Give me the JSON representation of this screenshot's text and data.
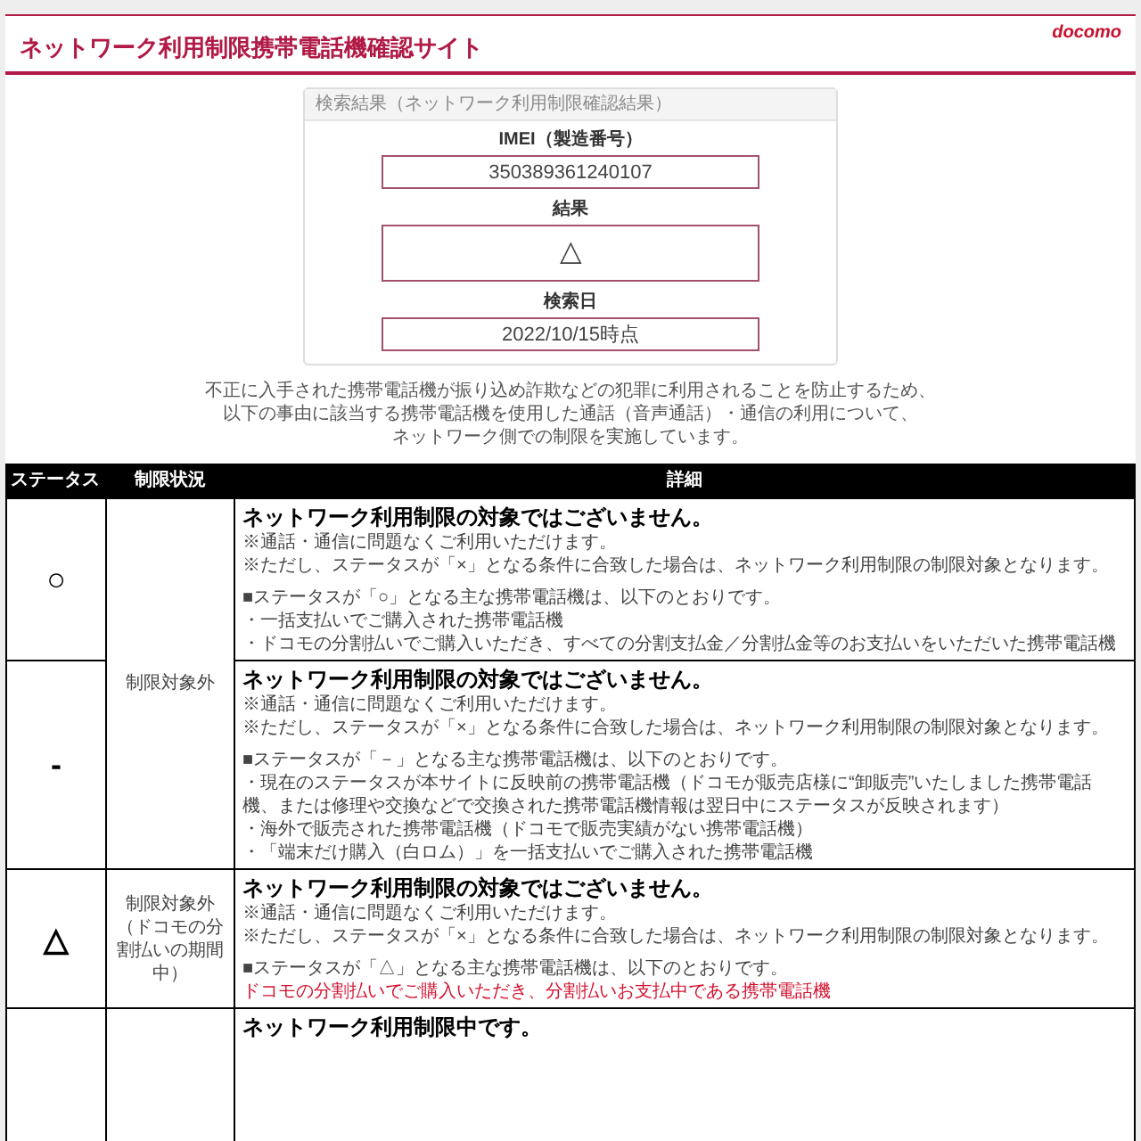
{
  "header": {
    "title": "ネットワーク利用制限携帯電話機確認サイト",
    "logo": "docomo"
  },
  "result": {
    "heading": "検索結果（ネットワーク利用制限確認結果）",
    "fields": [
      {
        "label": "IMEI（製造番号）",
        "value": "350389361240107",
        "kind": "text"
      },
      {
        "label": "結果",
        "value": "△",
        "kind": "symbol"
      },
      {
        "label": "検索日",
        "value": "2022/10/15時点",
        "kind": "text"
      }
    ]
  },
  "notice": [
    "不正に入手された携帯電話機が振り込め詐欺などの犯罪に利用されることを防止するため、",
    "以下の事由に該当する携帯電話機を使用した通話（音声通話）・通信の利用について、",
    "ネットワーク側での制限を実施しています。"
  ],
  "table": {
    "columns": [
      "ステータス",
      "制限状況",
      "詳細"
    ],
    "groups": [
      {
        "restriction": [
          "制限対象外"
        ],
        "rows": [
          {
            "status": "○",
            "detail": {
              "title": "ネットワーク利用制限の対象ではございません。",
              "notes": [
                "※通話・通信に問題なくご利用いただけます。",
                "※ただし、ステータスが「×」となる条件に合致した場合は、ネットワーク利用制限の制限対象となります。"
              ],
              "heading": "■ステータスが「○」となる主な携帯電話機は、以下のとおりです。",
              "items": [
                {
                  "text": "・一括支払いでご購入された携帯電話機",
                  "kind": "plain"
                },
                {
                  "text": "・ドコモの分割払いでご購入いただき、すべての分割支払金／分割払金等のお支払いをいただいた携帯電話機",
                  "kind": "plain"
                }
              ]
            }
          },
          {
            "status": "-",
            "detail": {
              "title": "ネットワーク利用制限の対象ではございません。",
              "notes": [
                "※通話・通信に問題なくご利用いただけます。",
                "※ただし、ステータスが「×」となる条件に合致した場合は、ネットワーク利用制限の制限対象となります。"
              ],
              "heading": "■ステータスが「－」となる主な携帯電話機は、以下のとおりです。",
              "items": [
                {
                  "text": "・現在のステータスが本サイトに反映前の携帯電話機（ドコモが販売店様に“卸販売”いたしました携帯電話機、または修理や交換などで交換された携帯電話機情報は翌日中にステータスが反映されます）",
                  "kind": "plain"
                },
                {
                  "text": "・海外で販売された携帯電話機（ドコモで販売実績がない携帯電話機）",
                  "kind": "plain"
                },
                {
                  "text": "・「端末だけ購入（白ロム）」を一括支払いでご購入された携帯電話機",
                  "kind": "plain"
                }
              ]
            }
          }
        ]
      },
      {
        "restriction": [
          "制限対象外",
          "（ドコモの分割払いの期間中）"
        ],
        "rows": [
          {
            "status": "△",
            "detail": {
              "title": "ネットワーク利用制限の対象ではございません。",
              "notes": [
                "※通話・通信に問題なくご利用いただけます。",
                "※ただし、ステータスが「×」となる条件に合致した場合は、ネットワーク利用制限の制限対象となります。"
              ],
              "heading": "■ステータスが「△」となる主な携帯電話機は、以下のとおりです。",
              "items": [
                {
                  "text": "ドコモの分割払いでご購入いただき、分割払いお支払中である携帯電話機",
                  "kind": "alert"
                }
              ]
            }
          }
        ]
      },
      {
        "rows": [
          {
            "detail": {
              "title": "ネットワーク利用制限中です。"
            }
          }
        ]
      }
    ]
  }
}
